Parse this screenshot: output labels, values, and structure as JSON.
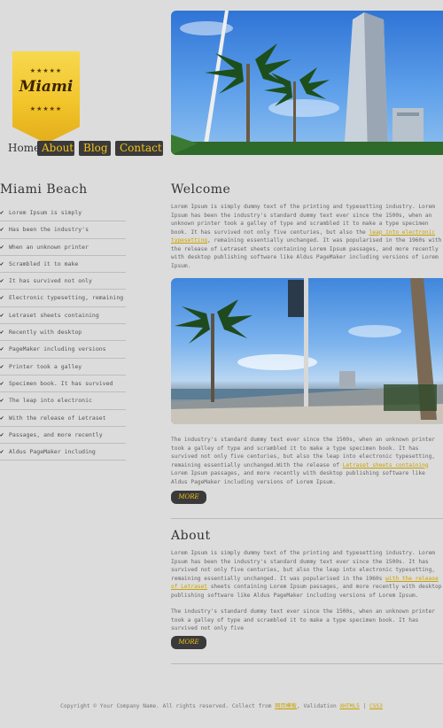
{
  "logo": {
    "stars_top": "★★★★★",
    "text": "Miami",
    "stars_bottom": "★★★★★"
  },
  "nav": {
    "home": "Home",
    "about": "About",
    "blog": "Blog",
    "contact": "Contact"
  },
  "sidebar": {
    "title": "Miami Beach",
    "items": [
      "Lorem Ipsum is simply",
      "Has been the industry's",
      "When an unknown printer",
      "Scrambled it to make",
      "It has survived not only",
      "Electronic typesetting, remaining",
      "Letraset sheets containing",
      "Recently with desktop",
      "PageMaker including versions",
      "Printer took a galley",
      "Specimen book. It has survived",
      "The leap into electronic",
      "With the release of Letraset",
      "Passages, and more recently",
      "Aldus PageMaker including"
    ]
  },
  "welcome": {
    "title": "Welcome",
    "p1_a": "Lorem Ipsum is simply dummy text of the printing and typesetting industry. Lorem Ipsum has been the industry's standard dummy text ever since the 1500s, when an unknown printer took a galley of type and scrambled it to make a type specimen book. It has survived not only five centuries, but also the ",
    "p1_link": "leap into electronic typesetting",
    "p1_b": ", remaining essentially unchanged. It was popularised in the 1960s with the release of Letraset sheets containing Lorem Ipsum passages, and more recently with desktop publishing software like Aldus PageMaker including versions of Lorem Ipsum.",
    "p2_a": "The industry's standard dummy text ever since the 1500s, when an unknown printer took a galley of type and scrambled it to make a type specimen book. It has survived not only five centuries, but also the leap into electronic typesetting, remaining essentially unchanged.With the release of ",
    "p2_link": "Letraset sheets containing",
    "p2_b": " Lorem Ipsum passages, and more recently with desktop publishing software like Aldus PageMaker including versions of Lorem Ipsum.",
    "more": "MORE"
  },
  "about": {
    "title": "About",
    "p1_a": "Lorem Ipsum is simply dummy text of the printing and typesetting industry. Lorem Ipsum has been the industry's standard dummy text ever since the 1500s. It has survived not only five centuries, but also the leap into electronic typesetting, remaining essentially unchanged. It was popularised in the 1960s ",
    "p1_link": "with the release of Letraset",
    "p1_b": " sheets containing Lorem Ipsum passages, and more recently with desktop publishing software like Aldus PageMaker including versions of Lorem Ipsum.",
    "p2": "The industry's standard dummy text ever since the 1500s, when an unknown printer took a galley of type and scrambled it to make a type specimen book. It has survived not only five",
    "more": "MORE"
  },
  "footer": {
    "text": "Copyright © Your Company Name. All rights reserved. Collect from ",
    "link1": "网页模板",
    "mid": ", Validation ",
    "link2": "XHTML5",
    "sep": " | ",
    "link3": "CSS3"
  }
}
